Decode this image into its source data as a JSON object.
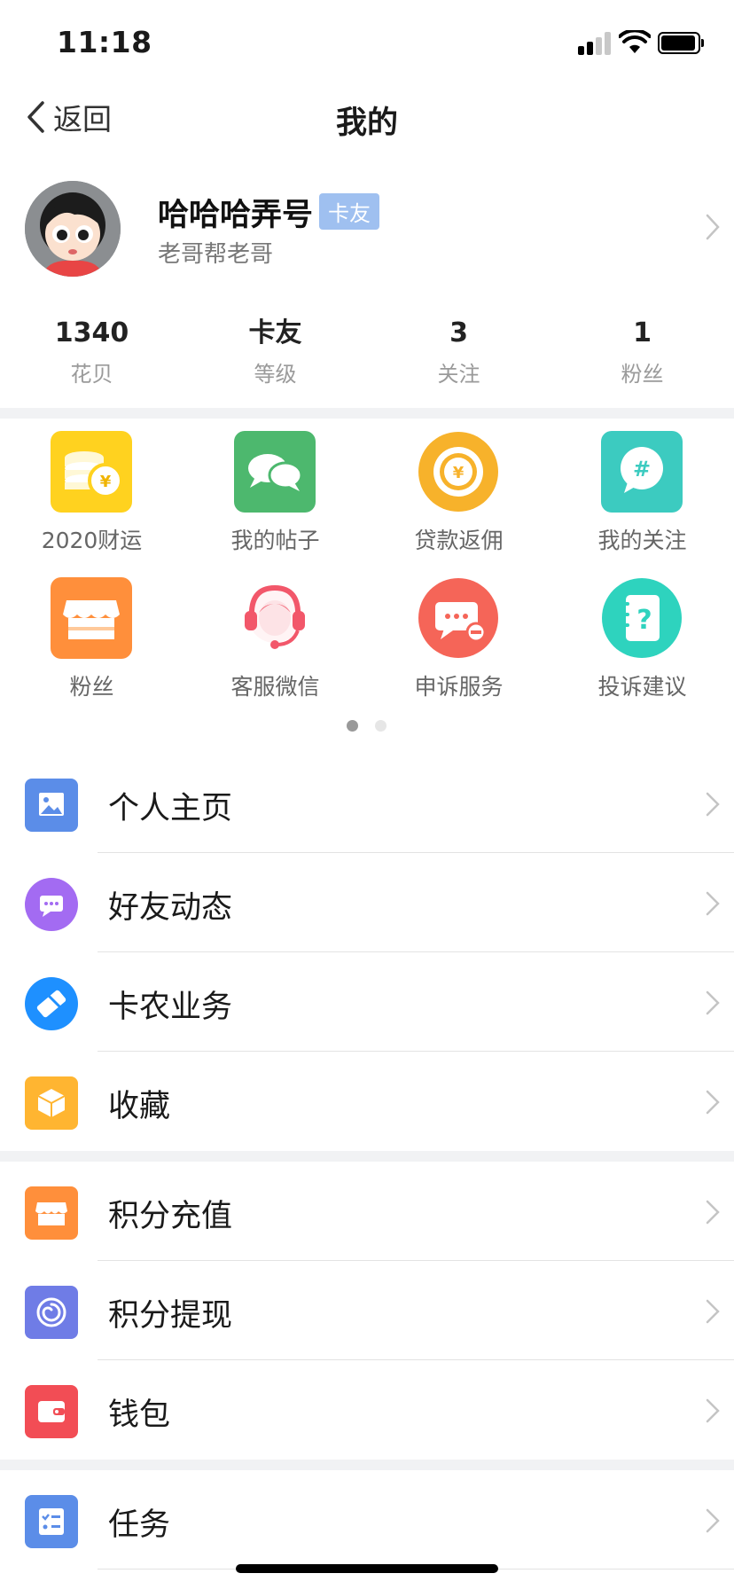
{
  "status_bar": {
    "time": "11:18"
  },
  "nav": {
    "back_label": "返回",
    "title": "我的"
  },
  "profile": {
    "username": "哈哈哈弄号",
    "badge": "卡友",
    "subtitle": "老哥帮老哥"
  },
  "stats": [
    {
      "value": "1340",
      "label": "花贝"
    },
    {
      "value": "卡友",
      "label": "等级"
    },
    {
      "value": "3",
      "label": "关注"
    },
    {
      "value": "1",
      "label": "粉丝"
    }
  ],
  "grid": [
    {
      "label": "2020财运",
      "icon": "coins-icon",
      "color": "#FFD21F"
    },
    {
      "label": "我的帖子",
      "icon": "chat-bubbles-icon",
      "color": "#4DB86E"
    },
    {
      "label": "贷款返佣",
      "icon": "yuan-coin-icon",
      "color": "#F7B22B"
    },
    {
      "label": "我的关注",
      "icon": "hashtag-bubble-icon",
      "color": "#3CCBC0"
    },
    {
      "label": "粉丝",
      "icon": "store-icon",
      "color": "#FF8F3B"
    },
    {
      "label": "客服微信",
      "icon": "headset-agent-icon",
      "color": "#F2576A"
    },
    {
      "label": "申诉服务",
      "icon": "message-minus-icon",
      "color": "#F56558"
    },
    {
      "label": "投诉建议",
      "icon": "question-notebook-icon",
      "color": "#2ED3BE"
    }
  ],
  "pager": {
    "active_color": "#999999",
    "inactive_color": "#e6e6e6"
  },
  "menu_group_1": [
    {
      "label": "个人主页",
      "icon": "image-icon",
      "color": "#5B8DE8"
    },
    {
      "label": "好友动态",
      "icon": "message-dots-icon",
      "color": "#A36BF2"
    },
    {
      "label": "卡农业务",
      "icon": "handshake-icon",
      "color": "#1E90FF"
    },
    {
      "label": "收藏",
      "icon": "box-icon",
      "color": "#FFB531"
    }
  ],
  "menu_group_2": [
    {
      "label": "积分充值",
      "icon": "store-icon",
      "color": "#FF8F3B"
    },
    {
      "label": "积分提现",
      "icon": "spiral-icon",
      "color": "#6F7CE6"
    },
    {
      "label": "钱包",
      "icon": "wallet-icon",
      "color": "#F24D55"
    }
  ],
  "menu_group_3": [
    {
      "label": "任务",
      "icon": "task-list-icon",
      "color": "#5B8DE8"
    }
  ]
}
